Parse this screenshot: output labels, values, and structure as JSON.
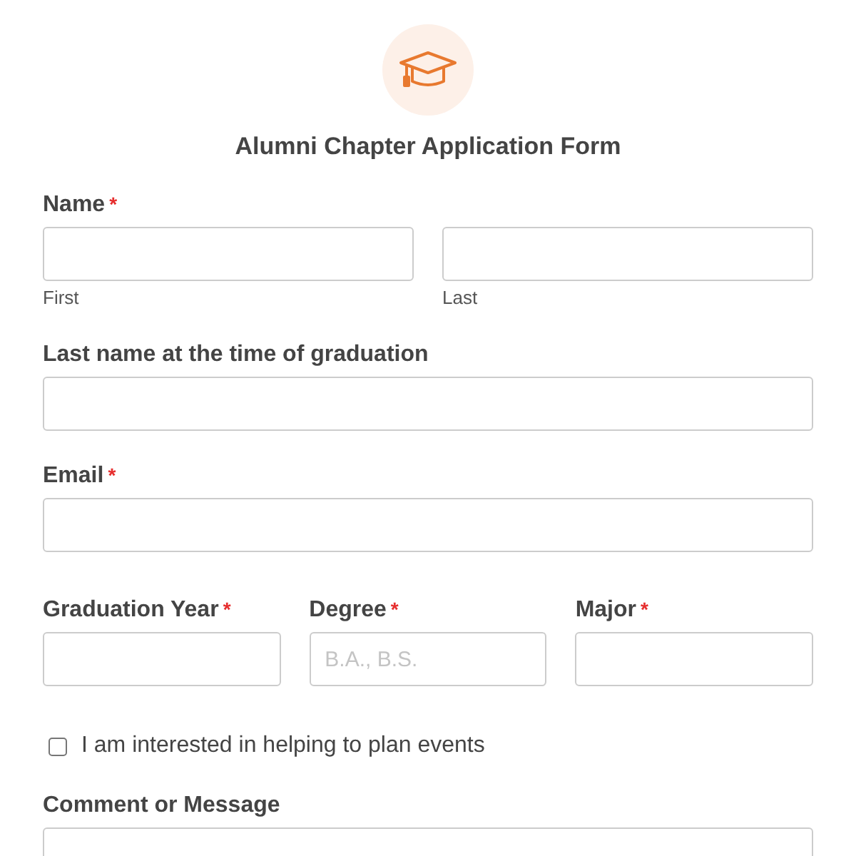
{
  "form": {
    "title": "Alumni Chapter Application Form",
    "fields": [
      {
        "kind": "name",
        "label": "Name",
        "required_mark": "*",
        "parts": [
          {
            "sublabel": "First"
          },
          {
            "sublabel": "Last"
          }
        ]
      },
      {
        "kind": "text",
        "label": "Last name at the time of graduation"
      },
      {
        "kind": "text",
        "label": "Email",
        "required_mark": "*"
      },
      {
        "kind": "row",
        "columns": [
          {
            "label": "Graduation Year",
            "required_mark": "*"
          },
          {
            "label": "Degree",
            "required_mark": "*",
            "placeholder": "B.A., B.S."
          },
          {
            "label": "Major",
            "required_mark": "*"
          }
        ]
      },
      {
        "kind": "checkbox",
        "label": "I am interested in helping to plan events",
        "checked": false
      },
      {
        "kind": "textarea",
        "label": "Comment or Message"
      }
    ]
  }
}
